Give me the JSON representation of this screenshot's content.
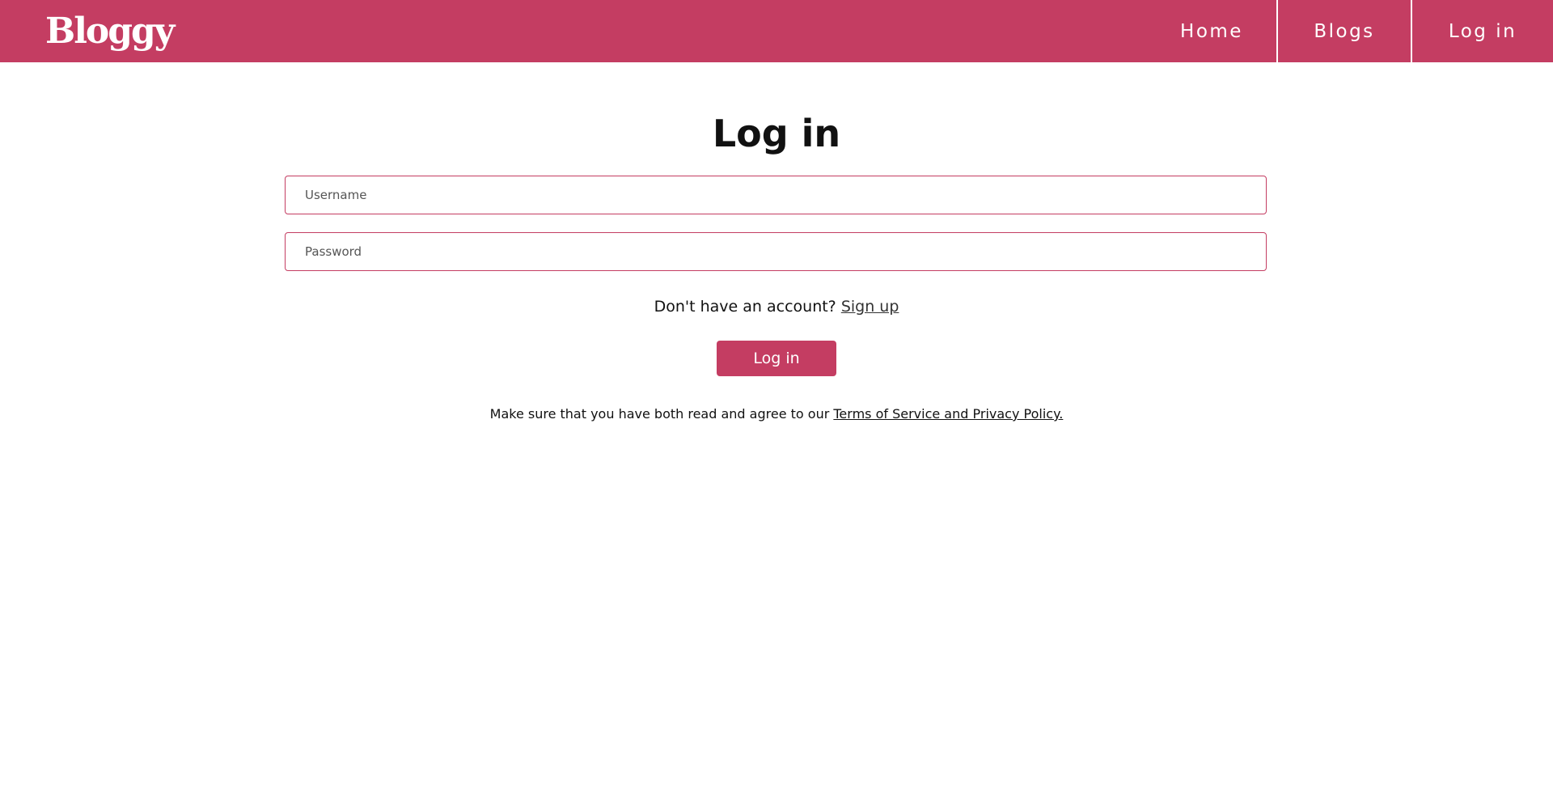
{
  "header": {
    "logo": "Bloggy",
    "nav": {
      "home": "Home",
      "blogs": "Blogs",
      "login": "Log in"
    }
  },
  "login_form": {
    "title": "Log in",
    "username": {
      "placeholder": "Username",
      "value": ""
    },
    "password": {
      "placeholder": "Password",
      "value": ""
    },
    "signup_prompt": "Don't have an account?",
    "signup_link": "Sign up",
    "submit_label": "Log in",
    "terms_prefix": "Make sure that you have both read and agree to our",
    "terms_link": "Terms of Service and Privacy Policy."
  },
  "colors": {
    "brand": "#c43d62",
    "nav_text": "#ffffff",
    "background": "#ffffff"
  }
}
